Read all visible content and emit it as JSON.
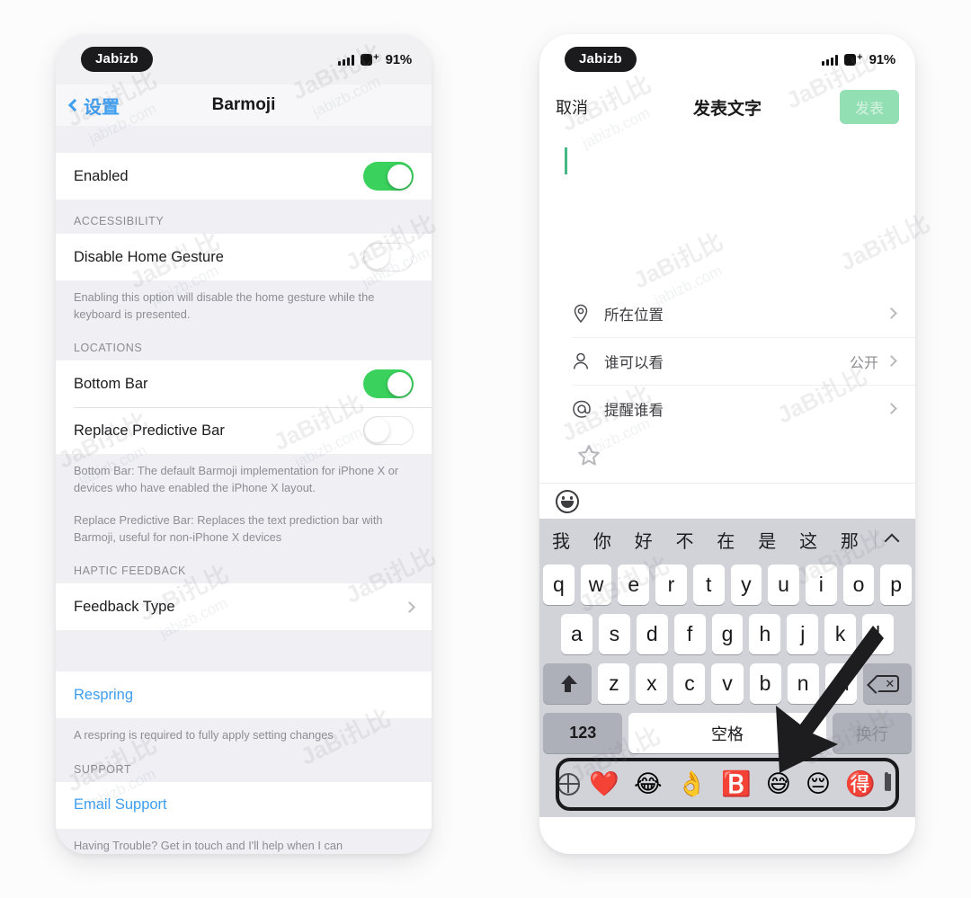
{
  "status_bar": {
    "carrier_badge": "Jabizb",
    "battery_percent": "91%",
    "signal_icon": "signal-bars-icon",
    "battery_icon": "battery-charging-icon"
  },
  "left_phone": {
    "nav": {
      "back_label": "设置",
      "back_icon": "chevron-left-icon",
      "title": "Barmoji"
    },
    "sections": [
      {
        "header": "",
        "cells": [
          {
            "label": "Enabled",
            "control": "toggle",
            "state": "on"
          }
        ],
        "notes": []
      },
      {
        "header": "ACCESSIBILITY",
        "cells": [
          {
            "label": "Disable Home Gesture",
            "control": "toggle",
            "state": "off"
          }
        ],
        "notes": [
          "Enabling this option will disable the home gesture while the keyboard is presented."
        ]
      },
      {
        "header": "LOCATIONS",
        "cells": [
          {
            "label": "Bottom Bar",
            "control": "toggle",
            "state": "on"
          },
          {
            "label": "Replace Predictive Bar",
            "control": "toggle",
            "state": "off"
          }
        ],
        "notes": [
          "Bottom Bar: The default Barmoji implementation for iPhone X or devices who have enabled the iPhone X layout.",
          "Replace Predictive Bar: Replaces the text prediction bar with Barmoji, useful for non-iPhone X devices"
        ]
      },
      {
        "header": "HAPTIC FEEDBACK",
        "cells": [
          {
            "label": "Feedback Type",
            "control": "disclosure",
            "state": ""
          }
        ],
        "notes": []
      },
      {
        "header": "",
        "cells": [
          {
            "label": "Respring",
            "control": "link",
            "state": ""
          }
        ],
        "notes": [
          "A respring is required to fully apply setting changes"
        ]
      },
      {
        "header": "SUPPORT",
        "cells": [
          {
            "label": "Email Support",
            "control": "link",
            "state": ""
          }
        ],
        "notes": [
          "Having Trouble? Get in touch and I'll help when I can"
        ]
      }
    ]
  },
  "right_phone": {
    "compose": {
      "cancel_label": "取消",
      "title": "发表文字",
      "publish_label": "发表",
      "caret": "text-cursor"
    },
    "options": [
      {
        "icon": "location-pin-icon",
        "label": "所在位置",
        "value": "",
        "accessory": "chevron-right-icon"
      },
      {
        "icon": "person-icon",
        "label": "谁可以看",
        "value": "公开",
        "accessory": "chevron-right-icon"
      },
      {
        "icon": "at-sign-icon",
        "label": "提醒谁看",
        "value": "",
        "accessory": "chevron-right-icon"
      }
    ],
    "star_icon": "star-outline-icon",
    "emoji_toggle_icon": "smiley-face-icon",
    "keyboard": {
      "predictions": [
        "我",
        "你",
        "好",
        "不",
        "在",
        "是",
        "这",
        "那"
      ],
      "collapse_icon": "chevron-up-icon",
      "row1": [
        "q",
        "w",
        "e",
        "r",
        "t",
        "y",
        "u",
        "i",
        "o",
        "p"
      ],
      "row2": [
        "a",
        "s",
        "d",
        "f",
        "g",
        "h",
        "j",
        "k",
        "l"
      ],
      "row3": [
        "z",
        "x",
        "c",
        "v",
        "b",
        "n",
        "m"
      ],
      "shift_icon": "shift-arrow-icon",
      "delete_icon": "backspace-icon",
      "numbers_label": "123",
      "space_label": "空格",
      "return_label": "换行"
    },
    "barmoji_bar": {
      "globe_icon": "globe-icon",
      "mic_icon": "microphone-icon",
      "emojis": [
        "❤️",
        "😂",
        "👌",
        "🅱️",
        "😅",
        "😔",
        "🉐"
      ]
    }
  },
  "annotations": {
    "arrow": "black-arrow-pointing-to-barmoji-bar",
    "watermark_primary": "JaBi扎比",
    "watermark_secondary": "jabizb.com"
  },
  "colors": {
    "toggle_on": "#3ad15d",
    "ios_link_blue": "#3e9ef0",
    "publish_green": "#93dfb4",
    "caret_green": "#44b883",
    "keyboard_bg": "#d1d3d9"
  }
}
